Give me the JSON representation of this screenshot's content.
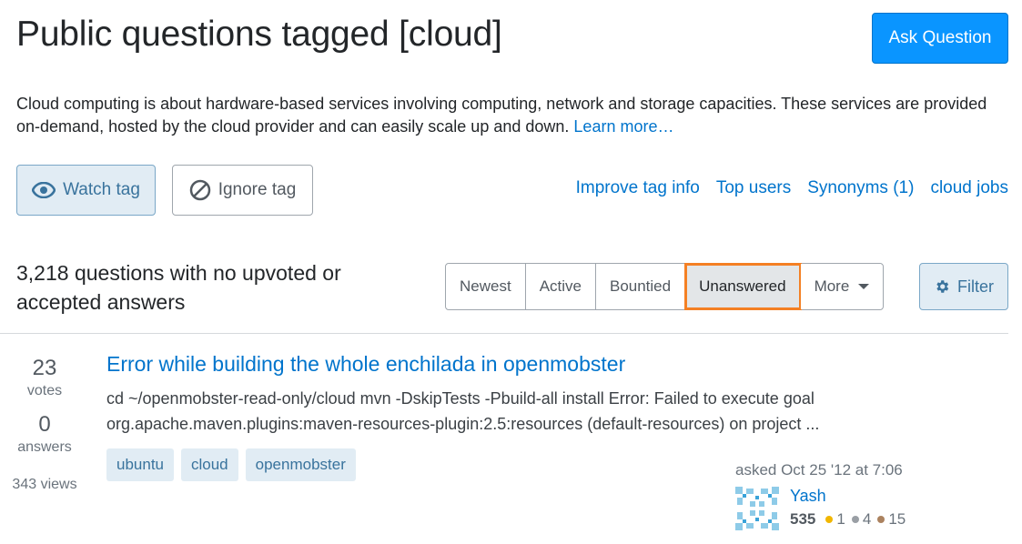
{
  "header": {
    "title": "Public questions tagged [cloud]",
    "ask_button": "Ask Question"
  },
  "tag_info": {
    "description": "Cloud computing is about hardware-based services involving computing, network and storage capacities. These services are provided on-demand, hosted by the cloud provider and can easily scale up and down.",
    "learn_more": "Learn more…"
  },
  "tag_actions": {
    "watch": "Watch tag",
    "ignore": "Ignore tag",
    "links": [
      "Improve tag info",
      "Top users",
      "Synonyms (1)",
      "cloud jobs"
    ]
  },
  "listing": {
    "count_text": "3,218 questions with no upvoted or accepted answers",
    "sort_tabs": [
      "Newest",
      "Active",
      "Bountied",
      "Unanswered",
      "More"
    ],
    "active_tab": "Unanswered",
    "filter": "Filter"
  },
  "question": {
    "votes": "23",
    "votes_label": "votes",
    "answers": "0",
    "answers_label": "answers",
    "views": "343 views",
    "title": "Error while building the whole enchilada in openmobster",
    "excerpt": "cd ~/openmobster-read-only/cloud mvn -DskipTests -Pbuild-all install Error: Failed to execute goal org.apache.maven.plugins:maven-resources-plugin:2.5:resources (default-resources) on project ...",
    "tags": [
      "ubuntu",
      "cloud",
      "openmobster"
    ],
    "asked": "asked Oct 25 '12 at 7:06",
    "user": {
      "name": "Yash",
      "reputation": "535",
      "gold": "1",
      "silver": "4",
      "bronze": "15"
    }
  },
  "colors": {
    "link": "#0074cc",
    "primary_button": "#0a95ff",
    "active_highlight": "#f48024",
    "gold": "#f1b600",
    "silver": "#9a9fa5",
    "bronze": "#ab825f"
  }
}
